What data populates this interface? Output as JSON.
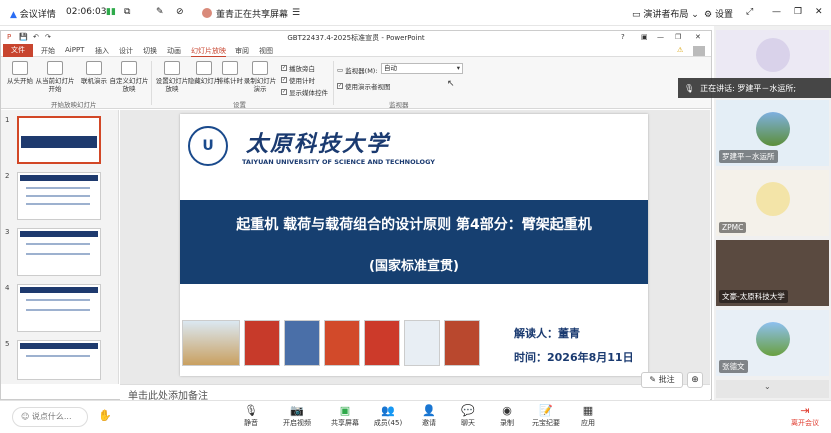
{
  "topbar": {
    "meeting_details": "会议详情",
    "timer": "02:06:03",
    "sharing": "董青正在共享屏幕",
    "presenter_layout": "演讲者布局",
    "settings": "设置"
  },
  "ppt": {
    "window_title": "GBT22437.4-2025标准宣贯 - PowerPoint",
    "help": "?",
    "tabs": [
      "文件",
      "开始",
      "AiPPT",
      "插入",
      "设计",
      "切换",
      "动画",
      "幻灯片放映",
      "审阅",
      "视图"
    ],
    "active_tab": "幻灯片放映",
    "ribbon": {
      "buttons": [
        "从头开始",
        "从当前幻灯片开始",
        "联机演示",
        "自定义幻灯片放映",
        "设置幻灯片放映",
        "隐藏幻灯片",
        "排练计时",
        "录制幻灯片演示"
      ],
      "checks": [
        "播放旁白",
        "使用计时",
        "显示媒体控件",
        "使用演示者视图"
      ],
      "monitor_label": "监视器(M):",
      "monitor_value": "自动",
      "groups": [
        "开始放映幻灯片",
        "设置",
        "监视器"
      ]
    },
    "thumbs": [
      "1",
      "2",
      "3",
      "4",
      "5"
    ],
    "slide": {
      "uni_cn": "太原科技大学",
      "uni_en": "TAIYUAN UNIVERSITY OF SCIENCE AND TECHNOLOGY",
      "title": "起重机  载荷与载荷组合的设计原则  第4部分：臂架起重机",
      "subtitle": "(国家标准宣贯)",
      "reader": "解读人：董青",
      "date": "时间：2026年8月11日"
    },
    "notes_placeholder": "单击此处添加备注",
    "annotate": "批注"
  },
  "side": {
    "speaking": "正在讲话:  罗建平－水运所;",
    "participants": [
      "罗建平－水运所",
      "ZPMC",
      "文豪-太原科技大学",
      "张德文"
    ]
  },
  "bottombar": {
    "say_placeholder": "说点什么...",
    "mute": "静音",
    "video": "开启视频",
    "share": "共享屏幕",
    "members": "成员(45)",
    "invite": "邀请",
    "chat": "聊天",
    "record": "录制",
    "summary": "元宝纪要",
    "apps": "应用",
    "leave": "离开会议"
  },
  "colors": {
    "accent": "#c8452f",
    "slide_blue": "#163f70",
    "leave": "#e03b2e"
  }
}
